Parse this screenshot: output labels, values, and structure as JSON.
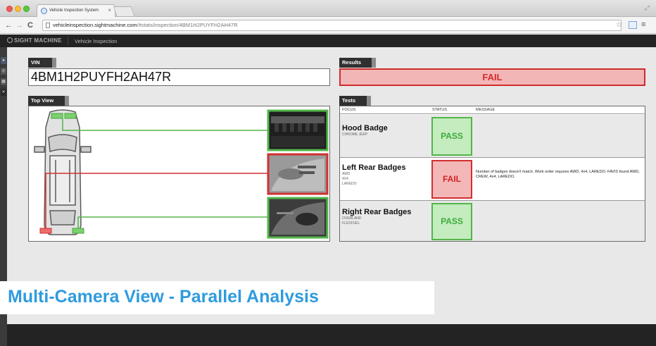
{
  "browser": {
    "tab_title": "Vehicle Inspection System",
    "tab_close": "×",
    "url_host": "vehicleinspection.sightmachine.com",
    "url_path": "/#stats/inspection/4BM1H2PUYFH2AH47R",
    "back": "←",
    "forward": "→",
    "reload": "C",
    "star": "☆",
    "menu": "≡",
    "resize": "⤢"
  },
  "app": {
    "brand": "SIGHT MACHINE",
    "title": "Vehicle Inspection"
  },
  "sidebar": {
    "icons": [
      "location-pin-icon",
      "camera-icon",
      "grid-icon",
      "tools-icon"
    ],
    "glyphs": [
      "●",
      "◎",
      "▦",
      "✕"
    ]
  },
  "vin": {
    "label": "VIN",
    "value": "4BM1H2PUYFH2AH47R"
  },
  "results": {
    "label": "Results",
    "value": "FAIL"
  },
  "top_view": {
    "label": "Top View",
    "links": [
      {
        "test": "Hood Badge",
        "status": "pass"
      },
      {
        "test": "Left Rear Badges",
        "status": "fail"
      },
      {
        "test": "Right Rear Badges",
        "status": "pass"
      }
    ]
  },
  "tests": {
    "label": "Tests",
    "headers": {
      "focus": "FOCUS",
      "status": "STATUS",
      "message": "MESSAGE"
    },
    "rows": [
      {
        "name": "Hood Badge",
        "details": [
          "CHROME JEEP"
        ],
        "status": "PASS",
        "message": ""
      },
      {
        "name": "Left Rear Badges",
        "details": [
          "AWD",
          "4X4",
          "LAREDO"
        ],
        "status": "FAIL",
        "message": "Number of badges doesn't match. Work order requires AWD, 4x4, LAREDO. FAVIS found AWD, CREW, 4x4, LAREDO."
      },
      {
        "name": "Right Rear Badges",
        "details": [
          "OVERLAND",
          "FLEXFUEL"
        ],
        "status": "PASS",
        "message": ""
      }
    ]
  },
  "caption": "Multi-Camera View - Parallel Analysis",
  "colors": {
    "pass": "#53b54a",
    "fail": "#d13030",
    "caption": "#2f9bde"
  }
}
